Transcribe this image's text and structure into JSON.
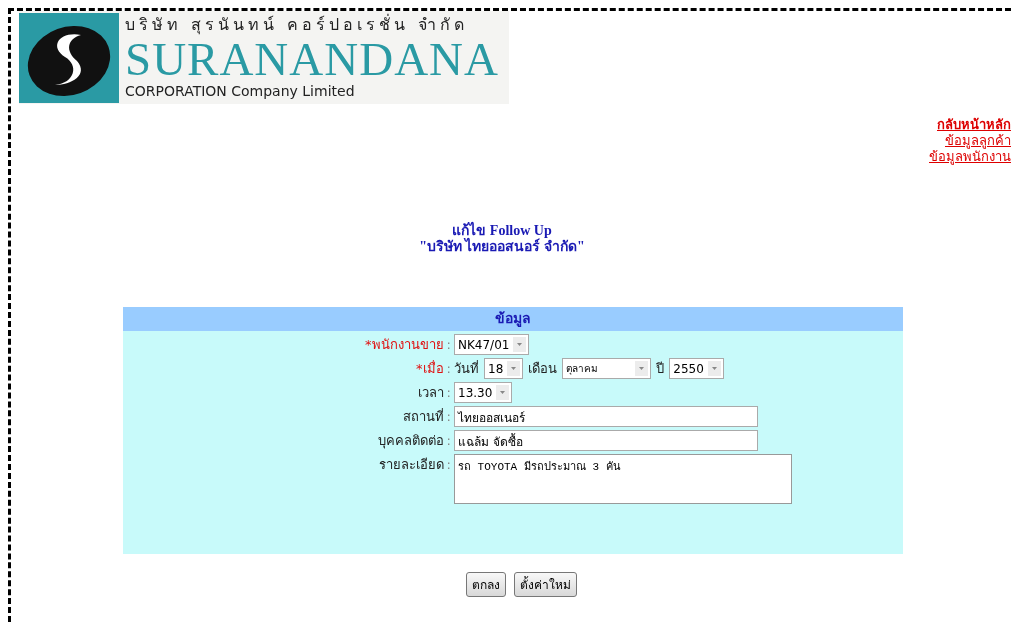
{
  "logo": {
    "thai_name": "บริษัท สุรนันทน์ คอร์ปอเรชั่น จำกัด",
    "name": "SURANANDANA",
    "subtitle": "CORPORATION Company Limited"
  },
  "nav_links": [
    "กลับหน้าหลัก",
    "ข้อมูลลูกค้า",
    "ข้อมูลพนักงาน"
  ],
  "page_title": "แก้ไข Follow Up",
  "company": "\"บริษัท ไทยออสนอร์ จำกัด\"",
  "form": {
    "header": "ข้อมูล",
    "rows": [
      {
        "kind": "select",
        "required": true,
        "mark": "*",
        "label": "พนักงานขาย",
        "colon": ":",
        "value": "NK47/01"
      },
      {
        "kind": "group",
        "required": true,
        "mark": "*",
        "label": "เมื่อ",
        "colon": ":",
        "parts": [
          {
            "prefix": "วันที่",
            "value": "18"
          },
          {
            "prefix": "เดือน",
            "value": "ตุลาคม"
          },
          {
            "prefix": "ปี",
            "value": "2550"
          }
        ]
      },
      {
        "kind": "select",
        "required": false,
        "label": "เวลา",
        "colon": ":",
        "value": "13.30"
      },
      {
        "kind": "text",
        "required": false,
        "label": "สถานที่",
        "colon": ":",
        "value": "ไทยออสเนอร์"
      },
      {
        "kind": "text",
        "required": false,
        "label": "บุคคลติดต่อ",
        "colon": ":",
        "value": "แฉล้ม จัดซื้อ"
      },
      {
        "kind": "textarea",
        "required": false,
        "label": "รายละเอียด",
        "colon": ":",
        "value": "รถ TOYOTA มีรถประมาณ 3 คัน"
      }
    ]
  },
  "buttons": [
    "ตกลง",
    "ตั้งค่าใหม่"
  ]
}
